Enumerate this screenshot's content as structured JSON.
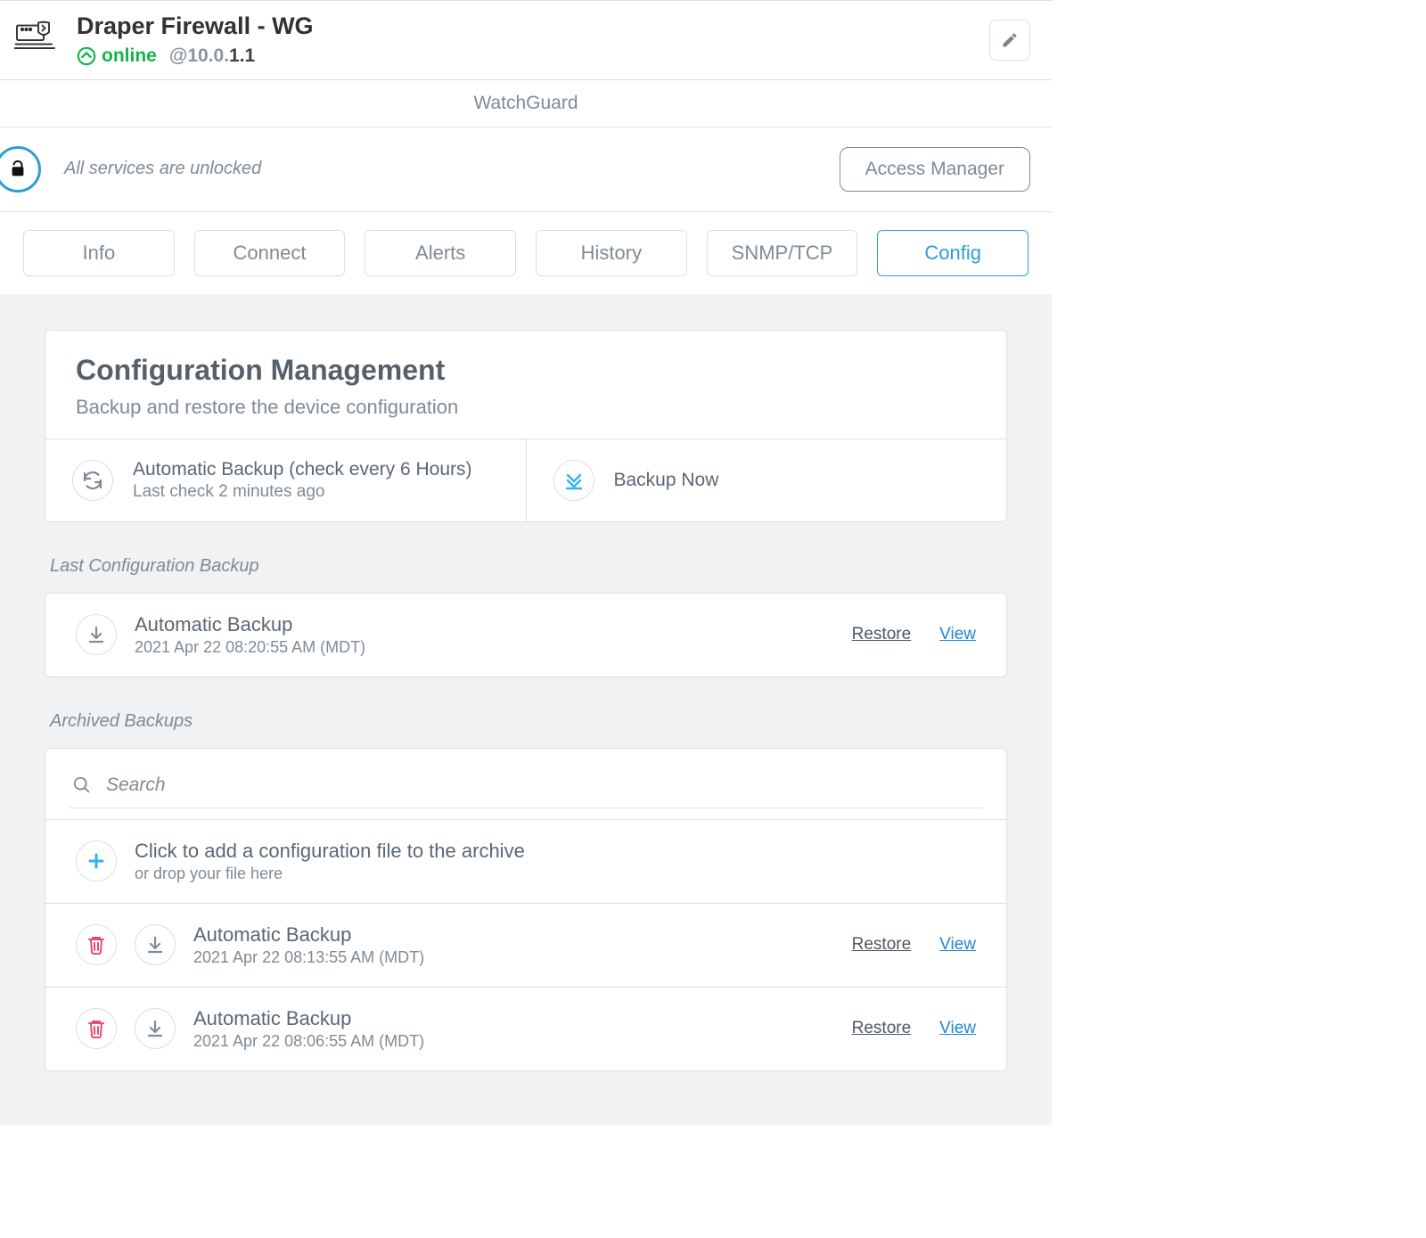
{
  "header": {
    "device_name": "Draper Firewall - WG",
    "status_text": "online",
    "ip_prefix": "@10.0.",
    "ip_suffix": "1.1",
    "vendor": "WatchGuard"
  },
  "lockbar": {
    "message": "All services are unlocked",
    "access_button": "Access Manager"
  },
  "tabs": [
    "Info",
    "Connect",
    "Alerts",
    "History",
    "SNMP/TCP",
    "Config"
  ],
  "active_tab": 5,
  "config": {
    "title": "Configuration Management",
    "subtitle": "Backup and restore the device configuration",
    "auto_backup": {
      "label": "Automatic Backup (check every 6 Hours)",
      "sub": "Last check 2 minutes ago"
    },
    "backup_now": "Backup Now",
    "section_last": "Last Configuration Backup",
    "last_backup": {
      "title": "Automatic Backup",
      "timestamp": "2021 Apr 22 08:20:55 AM (MDT)"
    },
    "section_archived": "Archived Backups",
    "search_placeholder": "Search",
    "upload": {
      "title": "Click to add a configuration file to the archive",
      "sub": "or drop your file here"
    },
    "archived": [
      {
        "title": "Automatic Backup",
        "timestamp": "2021 Apr 22 08:13:55 AM (MDT)"
      },
      {
        "title": "Automatic Backup",
        "timestamp": "2021 Apr 22 08:06:55 AM (MDT)"
      }
    ],
    "actions": {
      "restore": "Restore",
      "view": "View"
    }
  }
}
